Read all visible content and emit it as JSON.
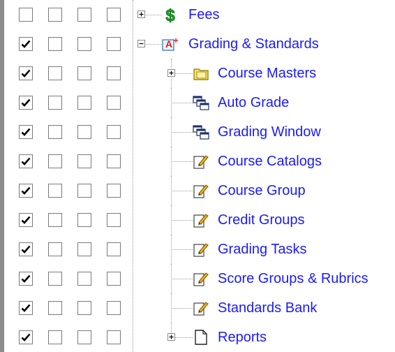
{
  "rows": [
    {
      "label": "Fees",
      "icon": "dollar-icon",
      "checked": false,
      "level": 0,
      "expander": "plus"
    },
    {
      "label": "Grading & Standards",
      "icon": "grading-icon",
      "checked": true,
      "level": 0,
      "expander": "minus"
    },
    {
      "label": "Course Masters",
      "icon": "folder-icon",
      "checked": true,
      "level": 1,
      "expander": "plus"
    },
    {
      "label": "Auto Grade",
      "icon": "windows-icon",
      "checked": true,
      "level": 1,
      "expander": null
    },
    {
      "label": "Grading Window",
      "icon": "windows-icon",
      "checked": true,
      "level": 1,
      "expander": null
    },
    {
      "label": "Course Catalogs",
      "icon": "edit-icon",
      "checked": true,
      "level": 1,
      "expander": null
    },
    {
      "label": "Course Group",
      "icon": "edit-icon",
      "checked": true,
      "level": 1,
      "expander": null
    },
    {
      "label": "Credit Groups",
      "icon": "edit-icon",
      "checked": true,
      "level": 1,
      "expander": null
    },
    {
      "label": "Grading Tasks",
      "icon": "edit-icon",
      "checked": true,
      "level": 1,
      "expander": null
    },
    {
      "label": "Score Groups & Rubrics",
      "icon": "edit-icon",
      "checked": true,
      "level": 1,
      "expander": null
    },
    {
      "label": "Standards Bank",
      "icon": "edit-icon",
      "checked": true,
      "level": 1,
      "expander": null
    },
    {
      "label": "Reports",
      "icon": "document-icon",
      "checked": true,
      "level": 1,
      "expander": "plus"
    }
  ],
  "colors": {
    "link": "#1a1aff",
    "check": "#000000",
    "leftbar": "#8c8c8c"
  }
}
